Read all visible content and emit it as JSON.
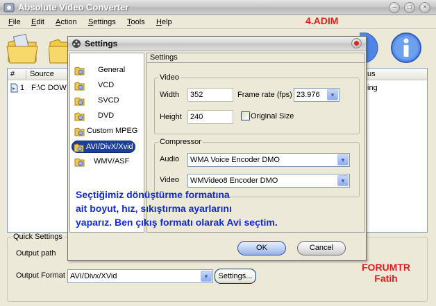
{
  "app": {
    "title": "Absolute Video Converter"
  },
  "menu": {
    "items": [
      {
        "pre": "",
        "u": "F",
        "post": "ile"
      },
      {
        "pre": "",
        "u": "E",
        "post": "dit"
      },
      {
        "pre": "",
        "u": "A",
        "post": "ction"
      },
      {
        "pre": "",
        "u": "S",
        "post": "ettings"
      },
      {
        "pre": "",
        "u": "T",
        "post": "ools"
      },
      {
        "pre": "",
        "u": "H",
        "post": "elp"
      }
    ]
  },
  "annotation": {
    "step": "4.ADIM",
    "body": "Seçtiğimiz dönüştürme formatına ait boyut, hız, sıkıştırma ayarlarını yaparız. Ben çıkış formatı olarak Avi seçtim.",
    "body_lines": [
      "Seçtiğimiz dönüştürme formatına",
      "ait boyut, hız, sıkıştırma ayarlarını",
      "yaparız. Ben çıkış formatı olarak Avi seçtim."
    ],
    "forum": "FORUMTR",
    "author": "Fatih"
  },
  "list": {
    "columns": [
      "#",
      "Source",
      "us"
    ],
    "rows": [
      {
        "num": "1",
        "source": "F:\\C DOW",
        "status": "ing"
      }
    ]
  },
  "quick_settings": {
    "legend": "Quick Settings",
    "output_path_label": "Output path",
    "output_format_label": "Output Format",
    "output_format_value": "AVI/Divx/XVid",
    "settings_button": "Settings..."
  },
  "settings_dialog": {
    "title": "Settings",
    "nav_items": [
      {
        "label": "General",
        "selected": false
      },
      {
        "label": "VCD",
        "selected": false
      },
      {
        "label": "SVCD",
        "selected": false
      },
      {
        "label": "DVD",
        "selected": false
      },
      {
        "label": "Custom MPEG",
        "selected": false
      },
      {
        "label": "AVI/DivX/Xvid",
        "selected": true
      },
      {
        "label": "WMV/ASF",
        "selected": false
      }
    ],
    "panel_title": "Settings",
    "video_group": {
      "legend": "Video",
      "width_label": "Width",
      "width_value": "352",
      "height_label": "Height",
      "height_value": "240",
      "framerate_label": "Frame rate (fps)",
      "framerate_value": "23.976",
      "original_size_label": "Original Size",
      "original_size_checked": false
    },
    "compressor_group": {
      "legend": "Compressor",
      "audio_label": "Audio",
      "audio_value": "WMA Voice Encoder DMO",
      "video_label": "Video",
      "video_value": "WMVideo8 Encoder DMO"
    },
    "ok_label": "OK",
    "cancel_label": "Cancel"
  },
  "colors": {
    "annotation_red": "#e21c1c",
    "annotation_blue": "#1428d8",
    "selected_nav": "#1c3f9e"
  }
}
